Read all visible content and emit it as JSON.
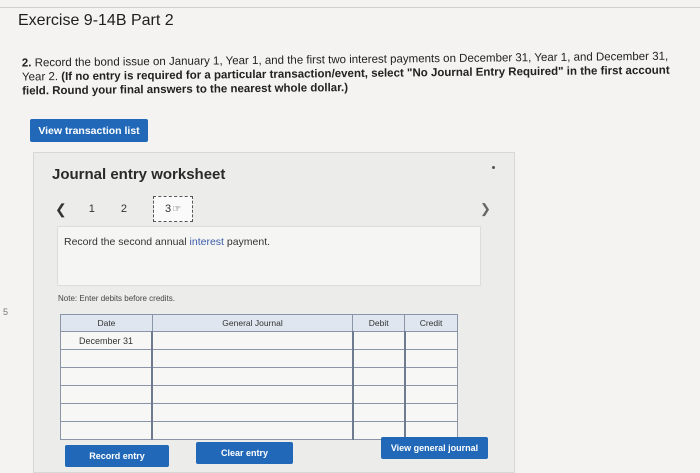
{
  "header": {
    "title": "Exercise 9-14B Part 2"
  },
  "instructions": {
    "number": "2.",
    "plain": "Record the bond issue on January 1, Year 1, and the first two interest payments on December 31, Year 1, and December 31, Year 2.",
    "bold": "(If no entry is required for a particular transaction/event, select \"No Journal Entry Required\" in the first account field. Round your final answers to the nearest whole dollar.)"
  },
  "buttons": {
    "view_transaction_list": "View transaction list",
    "record_entry": "Record entry",
    "clear_entry": "Clear entry",
    "view_general_journal": "View general journal"
  },
  "worksheet": {
    "title": "Journal entry worksheet",
    "pages": [
      "1",
      "2",
      "3"
    ],
    "active_page": "3",
    "instruction_prefix": "Record the second annual ",
    "instruction_highlight": "interest",
    "instruction_suffix": " payment.",
    "note": "Note: Enter debits before credits."
  },
  "table": {
    "headers": [
      "Date",
      "General Journal",
      "Debit",
      "Credit"
    ],
    "rows": [
      {
        "date": "December 31",
        "account": "",
        "debit": "",
        "credit": ""
      },
      {
        "date": "",
        "account": "",
        "debit": "",
        "credit": ""
      },
      {
        "date": "",
        "account": "",
        "debit": "",
        "credit": ""
      },
      {
        "date": "",
        "account": "",
        "debit": "",
        "credit": ""
      },
      {
        "date": "",
        "account": "",
        "debit": "",
        "credit": ""
      },
      {
        "date": "",
        "account": "",
        "debit": "",
        "credit": ""
      }
    ]
  },
  "margin": {
    "side_number": "5"
  },
  "icons": {
    "prev": "chevron-left-icon",
    "next": "chevron-right-icon",
    "cursor": "hand-cursor-icon"
  },
  "colors": {
    "button_blue": "#2169b8",
    "table_header": "#dfe6ef"
  }
}
